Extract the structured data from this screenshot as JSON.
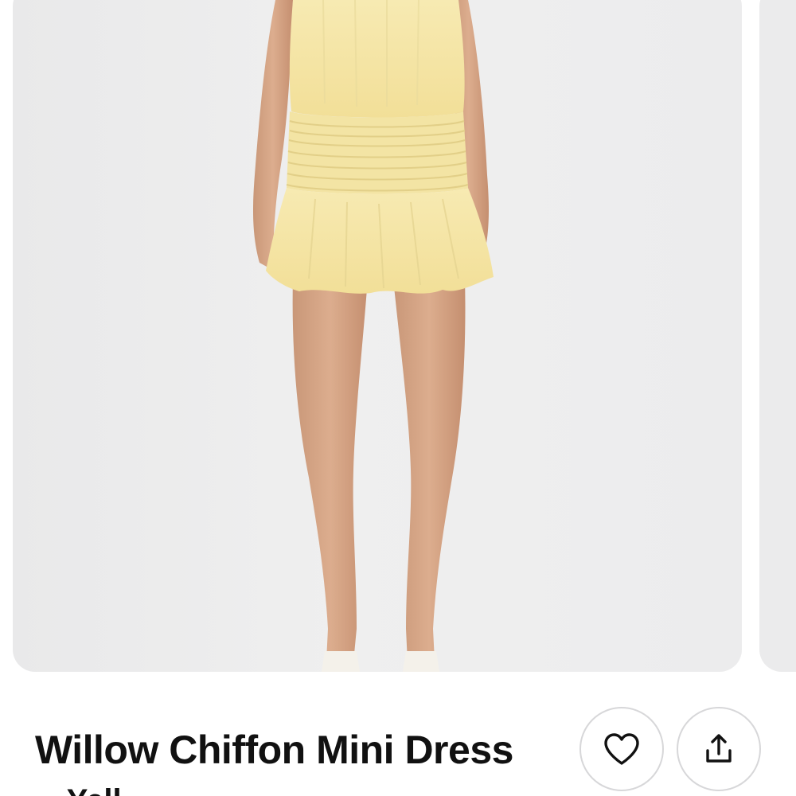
{
  "product": {
    "title": "Willow Chiffon Mini Dress",
    "subtitle_partial": "· Yell"
  },
  "carousel": {
    "image_alt": "Yellow chiffon mini dress with tiered ruffle skirt",
    "dress_color": "#f6e7a8",
    "background_color": "#ececed"
  },
  "actions": {
    "favorite_icon": "heart-icon",
    "share_icon": "share-icon"
  }
}
